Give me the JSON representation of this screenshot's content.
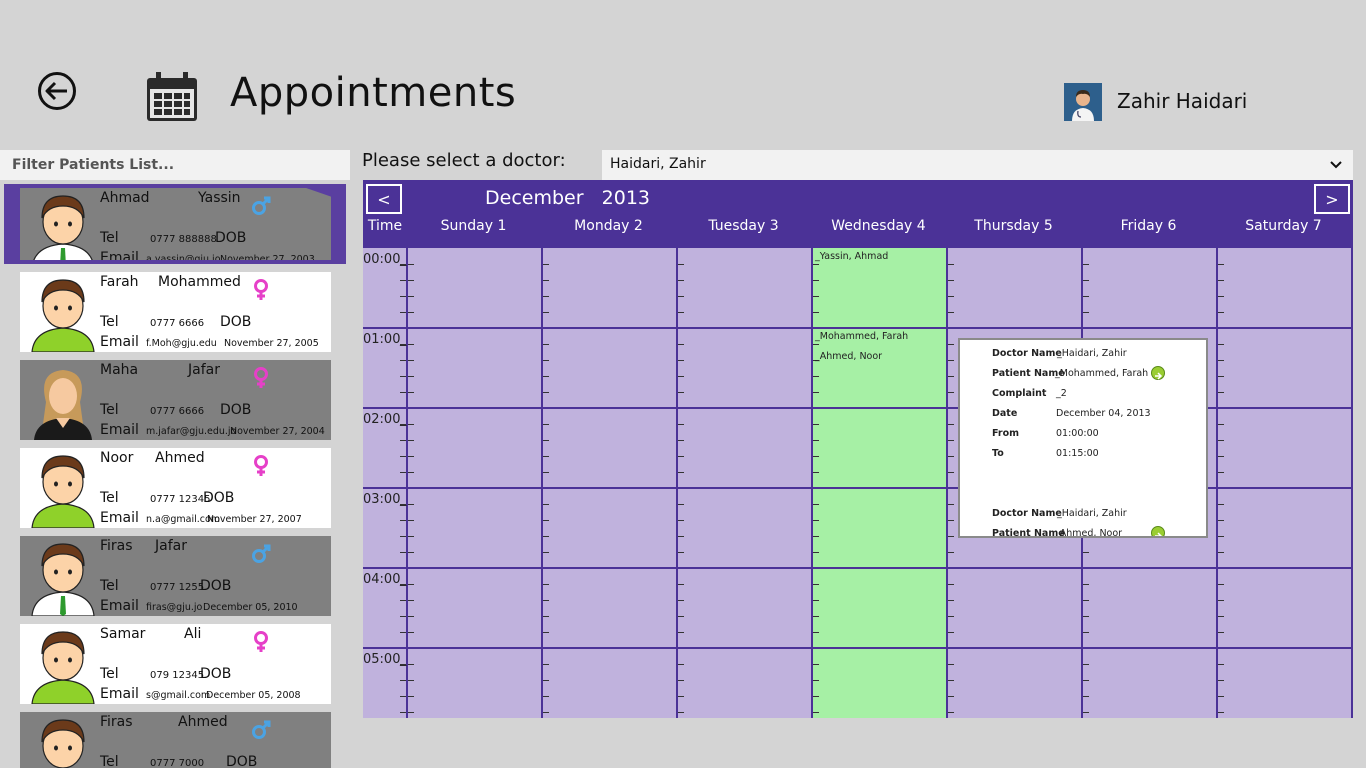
{
  "header": {
    "title": "Appointments",
    "user_name": "Zahir Haidari"
  },
  "filter": {
    "placeholder": "Filter Patients List..."
  },
  "patients": [
    {
      "first": "Ahmad",
      "last": "Yassin",
      "gender": "male",
      "tel": "0777 888888",
      "email": "a.yassin@gju.jo",
      "dob": "November 27, 2003",
      "style": "selected",
      "avatar": "boy"
    },
    {
      "first": "Farah",
      "last": "Mohammed",
      "gender": "female",
      "tel": "0777 6666",
      "email": "f.Moh@gju.edu",
      "dob": "November 27, 2005",
      "style": "white",
      "avatar": "girl-green"
    },
    {
      "first": "Maha",
      "last": "Jafar",
      "gender": "female",
      "tel": "0777 6666",
      "email": "m.jafar@gju.edu.jo",
      "dob": "November 27, 2004",
      "style": "grey",
      "avatar": "woman"
    },
    {
      "first": "Noor",
      "last": "Ahmed",
      "gender": "female",
      "tel": "0777 12345",
      "email": "n.a@gmail.com",
      "dob": "November 27, 2007",
      "style": "white",
      "avatar": "girl-green"
    },
    {
      "first": "Firas",
      "last": "Jafar",
      "gender": "male",
      "tel": "0777 1255",
      "email": "firas@gju.jo",
      "dob": "December 05, 2010",
      "style": "grey",
      "avatar": "boy"
    },
    {
      "first": "Samar",
      "last": "Ali",
      "gender": "female",
      "tel": "079 12345",
      "email": "s@gmail.com",
      "dob": "December 05, 2008",
      "style": "white",
      "avatar": "girl-green"
    },
    {
      "first": "Firas",
      "last": "Ahmed",
      "gender": "male",
      "tel": "0777 7000",
      "email": "",
      "dob": "",
      "style": "grey",
      "avatar": "boy"
    }
  ],
  "labels": {
    "tel": "Tel",
    "dob": "DOB",
    "email": "Email"
  },
  "doctor": {
    "label": "Please select a doctor:",
    "selected": "Haidari, Zahir"
  },
  "calendar": {
    "prev": "<",
    "next": ">",
    "month": "December",
    "year": "2013",
    "time_header": "Time",
    "days": [
      "Sunday 1",
      "Monday 2",
      "Tuesday 3",
      "Wednesday 4",
      "Thursday 5",
      "Friday 6",
      "Saturday 7"
    ],
    "highlight_day_index": 3,
    "hours": [
      "00:00",
      "01:00",
      "02:00",
      "03:00",
      "04:00",
      "05:00"
    ],
    "appointments": [
      {
        "day": 3,
        "slot": 0,
        "text": "_Yassin, Ahmad"
      },
      {
        "day": 3,
        "slot": 4,
        "text": "_Mohammed, Farah"
      },
      {
        "day": 3,
        "slot": 5,
        "text": "_Ahmed, Noor"
      }
    ]
  },
  "popup": {
    "labels": {
      "doctor": "Doctor Name",
      "patient": "Patient Name",
      "complaint": "Complaint",
      "date": "Date",
      "from": "From",
      "to": "To"
    },
    "entries": [
      {
        "doctor": "_Haidari, Zahir",
        "patient": "_Mohammed, Farah",
        "complaint": "_2",
        "date": "December 04, 2013",
        "from": "01:00:00",
        "to": "01:15:00"
      },
      {
        "doctor": "_Haidari, Zahir",
        "patient": "_Ahmed, Noor"
      }
    ]
  }
}
